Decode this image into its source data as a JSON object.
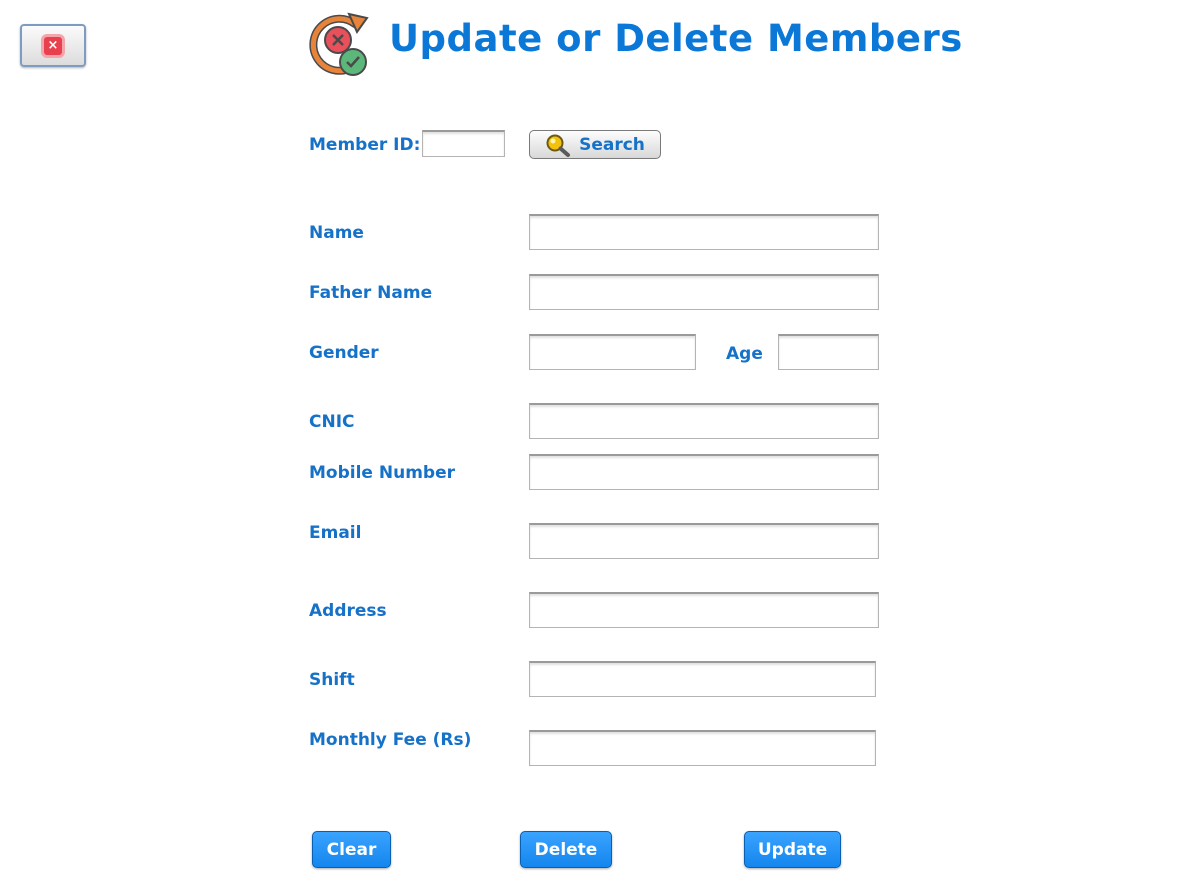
{
  "close_button": {
    "icon": "close-icon",
    "glyph": "×"
  },
  "header": {
    "title": "Update or Delete Members",
    "icon": "update-delete-icon"
  },
  "search": {
    "label": "Member ID:",
    "value": "",
    "button_label": "Search",
    "button_icon": "magnifier-icon"
  },
  "form": {
    "name_label": "Name",
    "father_name_label": "Father Name",
    "gender_label": "Gender",
    "age_label": "Age",
    "cnic_label": "CNIC",
    "mobile_label": "Mobile Number",
    "email_label": "Email",
    "address_label": "Address",
    "shift_label": "Shift",
    "fee_label": "Monthly Fee (Rs)",
    "values": {
      "name": "",
      "father_name": "",
      "gender": "",
      "age": "",
      "cnic": "",
      "mobile": "",
      "email": "",
      "address": "",
      "shift": "",
      "fee": ""
    }
  },
  "actions": {
    "clear": "Clear",
    "delete": "Delete",
    "update": "Update"
  },
  "colors": {
    "label": "#1672c8",
    "title": "#0b78d8",
    "button": "#1486ee"
  }
}
